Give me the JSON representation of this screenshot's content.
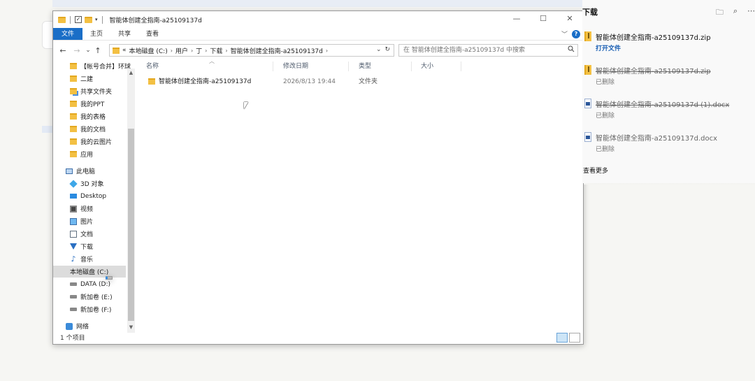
{
  "explorer": {
    "title": "智能体创建全指南-a25109137d",
    "window_controls": {
      "minimize": "—",
      "maximize": "☐",
      "close": "✕"
    },
    "ribbon_tabs": [
      "文件",
      "主页",
      "共享",
      "查看"
    ],
    "nav": {
      "back": "←",
      "forward": "→",
      "recent": "⌄",
      "up": "↑"
    },
    "address": {
      "prefix": "«",
      "crumbs": [
        "本地磁盘 (C:)",
        "用户",
        "丁",
        "下载",
        "智能体创建全指南-a25109137d"
      ],
      "sep": "›"
    },
    "search_placeholder": "在 智能体创建全指南-a25109137d 中搜索",
    "sidebar": [
      {
        "label": "【帐号合并】环球",
        "icon": "folder"
      },
      {
        "label": "二建",
        "icon": "folder"
      },
      {
        "label": "共享文件夹",
        "icon": "share"
      },
      {
        "label": "我的PPT",
        "icon": "folder"
      },
      {
        "label": "我的表格",
        "icon": "folder"
      },
      {
        "label": "我的文档",
        "icon": "folder"
      },
      {
        "label": "我的云图片",
        "icon": "folder"
      },
      {
        "label": "应用",
        "icon": "folder"
      },
      {
        "label": "此电脑",
        "icon": "pc"
      },
      {
        "label": "3D 对象",
        "icon": "cube"
      },
      {
        "label": "Desktop",
        "icon": "desk"
      },
      {
        "label": "视频",
        "icon": "video"
      },
      {
        "label": "图片",
        "icon": "pic"
      },
      {
        "label": "文档",
        "icon": "doc"
      },
      {
        "label": "下载",
        "icon": "dl"
      },
      {
        "label": "音乐",
        "icon": "music"
      },
      {
        "label": "本地磁盘 (C:)",
        "icon": "drive-win"
      },
      {
        "label": "DATA (D:)",
        "icon": "drive"
      },
      {
        "label": "新加卷 (E:)",
        "icon": "drive"
      },
      {
        "label": "新加卷 (F:)",
        "icon": "drive"
      },
      {
        "label": "网络",
        "icon": "net"
      }
    ],
    "columns": [
      "名称",
      "修改日期",
      "类型",
      "大小"
    ],
    "files": [
      {
        "name": "智能体创建全指南-a25109137d",
        "date": "2026/8/13 19:44",
        "type": "文件夹",
        "size": ""
      }
    ],
    "status": "1 个项目"
  },
  "downloads": {
    "title": "下载",
    "tools": {
      "folder": "🗀",
      "search": "⌕",
      "more": "⋯"
    },
    "items": [
      {
        "name": "智能体创建全指南-a25109137d.zip",
        "status": "打开文件",
        "deleted": false,
        "icon": "zip"
      },
      {
        "name": "智能体创建全指南-a25109137d.zip",
        "status": "已删除",
        "deleted": true,
        "icon": "zip"
      },
      {
        "name": "智能体创建全指南-a25109137d (1).docx",
        "status": "已删除",
        "deleted": true,
        "icon": "docx"
      },
      {
        "name": "智能体创建全指南-a25109137d.docx",
        "status": "已删除",
        "deleted": false,
        "icon": "docx"
      }
    ],
    "more": "查看更多"
  }
}
